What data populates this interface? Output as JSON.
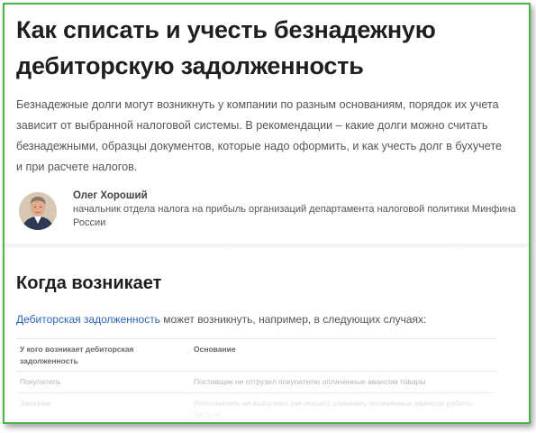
{
  "article": {
    "title": "Как списать и учесть безнадежную дебиторскую задолженность",
    "lead": "Безнадежные долги могут возникнуть у компании по разным основаниям, порядок их учета зависит от выбранной налоговой системы. В рекомендации – какие долги можно считать безнадежными, образцы документов, которые надо оформить, и как учесть долг в бухучете и при расчете налогов."
  },
  "author": {
    "name": "Олег Хороший",
    "position": "начальник отдела налога на прибыль организаций департамента налоговой политики Минфина России"
  },
  "section": {
    "title": "Когда возникает",
    "intro_link": "Дебиторская задолженность",
    "intro_text": " может возникнуть, например, в следующих случаях:"
  },
  "table": {
    "headers": [
      "У кого возникает дебиторская задолженность",
      "Основание"
    ],
    "rows": [
      [
        "Покупатель",
        "Поставщик не отгрузил покупателю оплаченные авансом товары"
      ],
      [
        "Заказчик",
        "Исполнитель не выполнил (не оказал) заказчику оплаченные авансом работы (услуги)"
      ]
    ]
  },
  "colors": {
    "frame_border": "#4bb34b",
    "link": "#2b65b5",
    "heading": "#1f1f1f"
  }
}
